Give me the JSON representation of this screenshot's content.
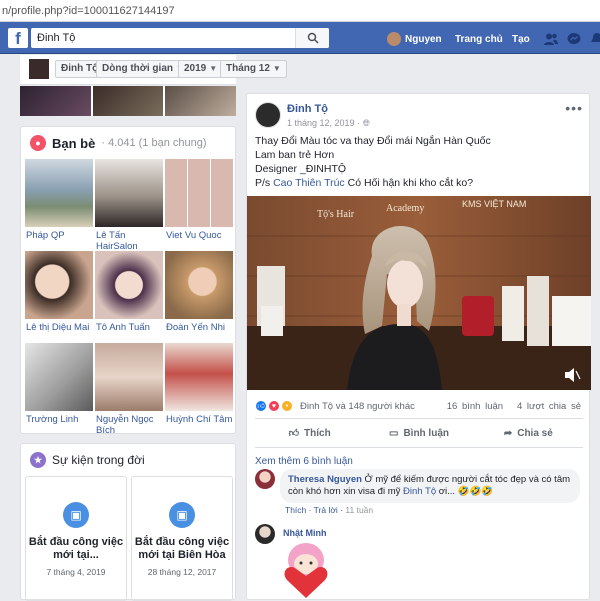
{
  "browser": {
    "url": "n/profile.php?id=100011627144197"
  },
  "topbar": {
    "search_value": "Đinh Tộ",
    "user_name": "Nguyen",
    "home": "Trang chủ",
    "create": "Tạo"
  },
  "subnav": {
    "name": "Đinh Tộ",
    "timeline": "Dòng thời gian",
    "year": "2019",
    "month": "Tháng 12"
  },
  "friends": {
    "title": "Bạn bè",
    "count": "· 4.041 (1 bạn chung)",
    "items": [
      {
        "name": "Pháp QP",
        "color": "#6a7c8a"
      },
      {
        "name": "Lê Tấn HairSalon",
        "color": "#8a7a6a"
      },
      {
        "name": "Viet Vu Quoc",
        "color": "#c9a9a0"
      },
      {
        "name": "Lê thị Diệu Mai",
        "color": "#caa891"
      },
      {
        "name": "Tô Anh Tuấn",
        "color": "#d8b3a2"
      },
      {
        "name": "Đoàn Yến Nhi",
        "color": "#b88e6e"
      },
      {
        "name": "Trường Linh",
        "color": "#b7b7b7"
      },
      {
        "name": "Nguyễn Ngọc Bích",
        "color": "#b79a8c"
      },
      {
        "name": "Huỳnh Chí Tâm",
        "color": "#b86a5a"
      }
    ]
  },
  "events": {
    "title": "Sự kiện trong đời",
    "items": [
      {
        "title": "Bắt đầu công việc mới tại...",
        "date": "7 tháng 4, 2019"
      },
      {
        "title": "Bắt đầu công việc mới tại Biên Hòa",
        "date": "28 tháng 12, 2017"
      }
    ]
  },
  "post": {
    "author": "Đinh Tộ",
    "date": "1 tháng 12, 2019 · ",
    "line1": "Thay Đổi Màu tóc va thay Đổi mái Ngắn Hàn Quốc",
    "line2": "Lam ban trẻ Hơn",
    "line3": "Designer _ĐINHTỘ",
    "line4_prefix": "P/s ",
    "line4_link": "Cao Thiên Trúc",
    "line4_suffix": " Có Hối hận khi kho cắt ko?",
    "image_signs": {
      "left": "Tộ's Hair",
      "middle": "Academy",
      "right": "KMS VIỆT NAM"
    },
    "reactions_text": "Đinh Tộ và 148 người khác",
    "comments_count": "16 bình luận",
    "shares_count": "4 lượt chia sẻ",
    "like": "Thích",
    "comment": "Bình luận",
    "share": "Chia sẻ",
    "more_comments": "Xem thêm 6 bình luận",
    "comment1": {
      "name": "Theresa Nguyen",
      "text": " Ở mỹ để kiếm được người cắt tóc đẹp và có tâm còn khó hơn xin visa đi mỹ ",
      "tag": "Đinh Tộ",
      "tail": " ơi... 🤣🤣🤣",
      "like": "Thích",
      "reply": "Trả lời",
      "time": "11 tuần"
    },
    "comment2": {
      "name": "Nhật Minh"
    }
  },
  "colors": {
    "fb_blue": "#4267b2",
    "link": "#365899",
    "bg": "#e9ebee"
  }
}
